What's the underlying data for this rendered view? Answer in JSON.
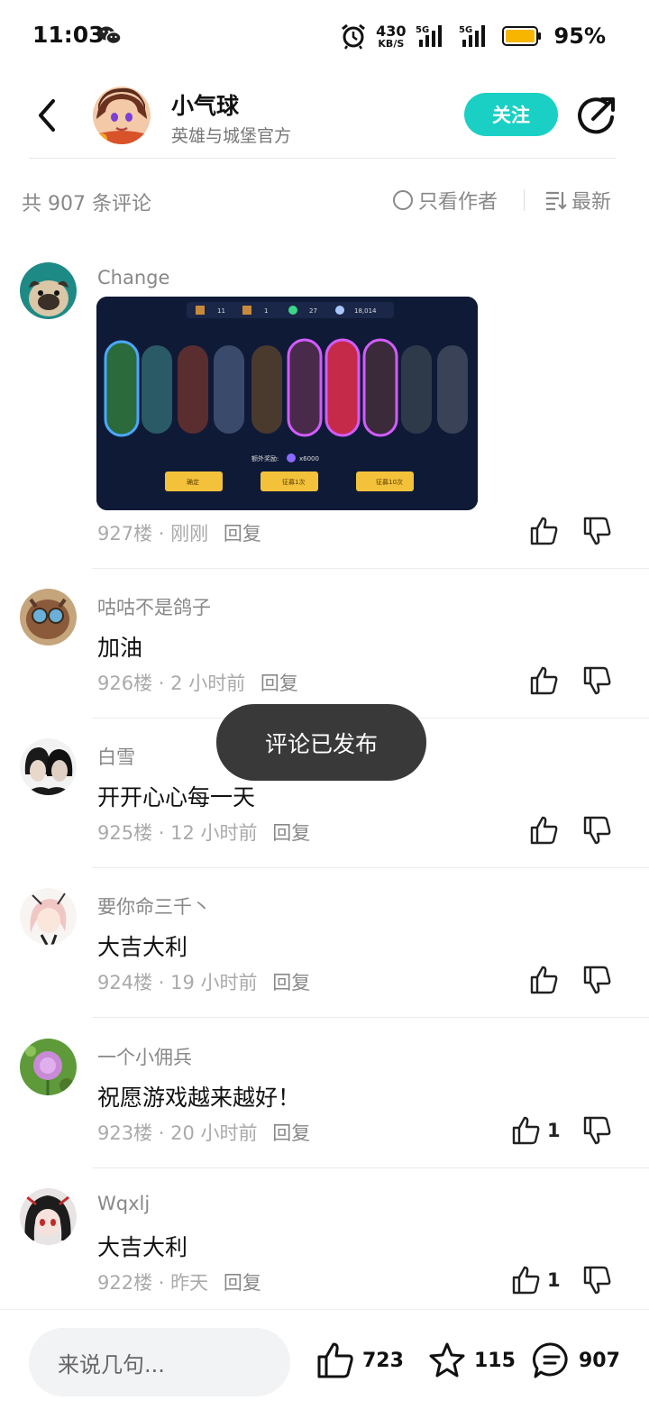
{
  "status_bar": {
    "time": "11:03",
    "net_speed": "430",
    "net_unit": "KB/S",
    "signal_1": "5G",
    "signal_2": "5G",
    "battery": "95%"
  },
  "header": {
    "name": "小气球",
    "subtitle": "英雄与城堡官方",
    "follow_label": "关注"
  },
  "filter": {
    "count_text": "共 907 条评论",
    "only_author": "只看作者",
    "sort": "最新"
  },
  "comments": [
    {
      "user": "Change",
      "text": "",
      "floor": "927楼",
      "time": "刚刚",
      "reply": "回复",
      "likes": "",
      "has_image": true,
      "image_text": {
        "top_1": "11",
        "top_2": "1",
        "top_3": "27",
        "top_4": "18,014",
        "extra": "额外奖励:",
        "extra_val": "x6000",
        "btn_1": "确定",
        "btn_2": "征募1次",
        "btn_3": "征募10次"
      }
    },
    {
      "user": "咕咕不是鸽子",
      "text": "加油",
      "floor": "926楼",
      "time": "2 小时前",
      "reply": "回复",
      "likes": ""
    },
    {
      "user": "白雪",
      "text": "开开心心每一天",
      "floor": "925楼",
      "time": "12 小时前",
      "reply": "回复",
      "likes": ""
    },
    {
      "user": "要你命三千丶",
      "text": "大吉大利",
      "floor": "924楼",
      "time": "19 小时前",
      "reply": "回复",
      "likes": ""
    },
    {
      "user": "一个小佣兵",
      "text": "祝愿游戏越来越好！",
      "floor": "923楼",
      "time": "20 小时前",
      "reply": "回复",
      "likes": "1"
    },
    {
      "user": "Wqxlj",
      "text": "大吉大利",
      "floor": "922楼",
      "time": "昨天",
      "reply": "回复",
      "likes": "1"
    }
  ],
  "meta_separator": "·",
  "toast": "评论已发布",
  "bottom": {
    "input_placeholder": "来说几句...",
    "likes": "723",
    "favorites": "115",
    "comments": "907"
  },
  "colors": {
    "accent": "#1ad0c4",
    "battery": "#f7b500"
  }
}
